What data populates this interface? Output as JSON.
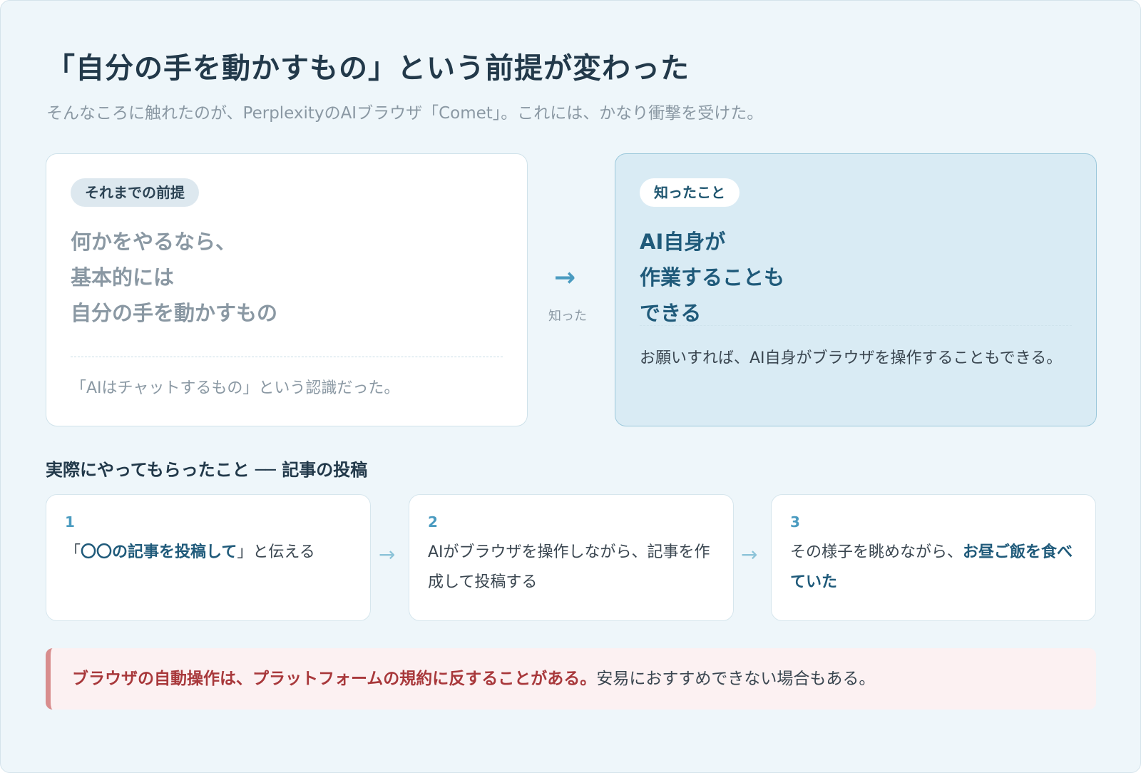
{
  "header": {
    "title": "「自分の手を動かすもの」という前提が変わった",
    "subtitle": "そんなころに触れたのが、PerplexityのAIブラウザ「Comet」。これには、かなり衝撃を受けた。"
  },
  "before_card": {
    "pill": "それまでの前提",
    "lines": [
      "何かをやるなら、",
      "基本的には",
      "自分の手を動かすもの"
    ],
    "note": "「AIはチャットするもの」という認識だった。"
  },
  "transition": {
    "arrow": "→",
    "label": "知った"
  },
  "after_card": {
    "pill": "知ったこと",
    "lines": [
      "AI自身が",
      "作業することも",
      "できる"
    ],
    "note": "お願いすれば、AI自身がブラウザを操作することもできる。"
  },
  "steps_section": {
    "title": "実際にやってもらったこと ── 記事の投稿",
    "arrow": "→",
    "steps": [
      {
        "num": "1",
        "pre": "「",
        "strong": "〇〇の記事を投稿して",
        "post": "」と伝える"
      },
      {
        "num": "2",
        "pre": "AIがブラウザを操作しながら、記事を作成して投稿する",
        "strong": "",
        "post": ""
      },
      {
        "num": "3",
        "pre": "その様子を眺めながら、",
        "strong": "お昼ご飯を食べていた",
        "post": ""
      }
    ]
  },
  "warning": {
    "strong": "ブラウザの自動操作は、プラットフォームの規約に反することがある。",
    "rest": "安易におすすめできない場合もある。"
  },
  "colors": {
    "accent": "#4a9bc0",
    "dark_text": "#22394a",
    "highlight_card": "#d9ebf4",
    "warning_text": "#a8383b",
    "warning_bg": "#fcf1f2"
  }
}
